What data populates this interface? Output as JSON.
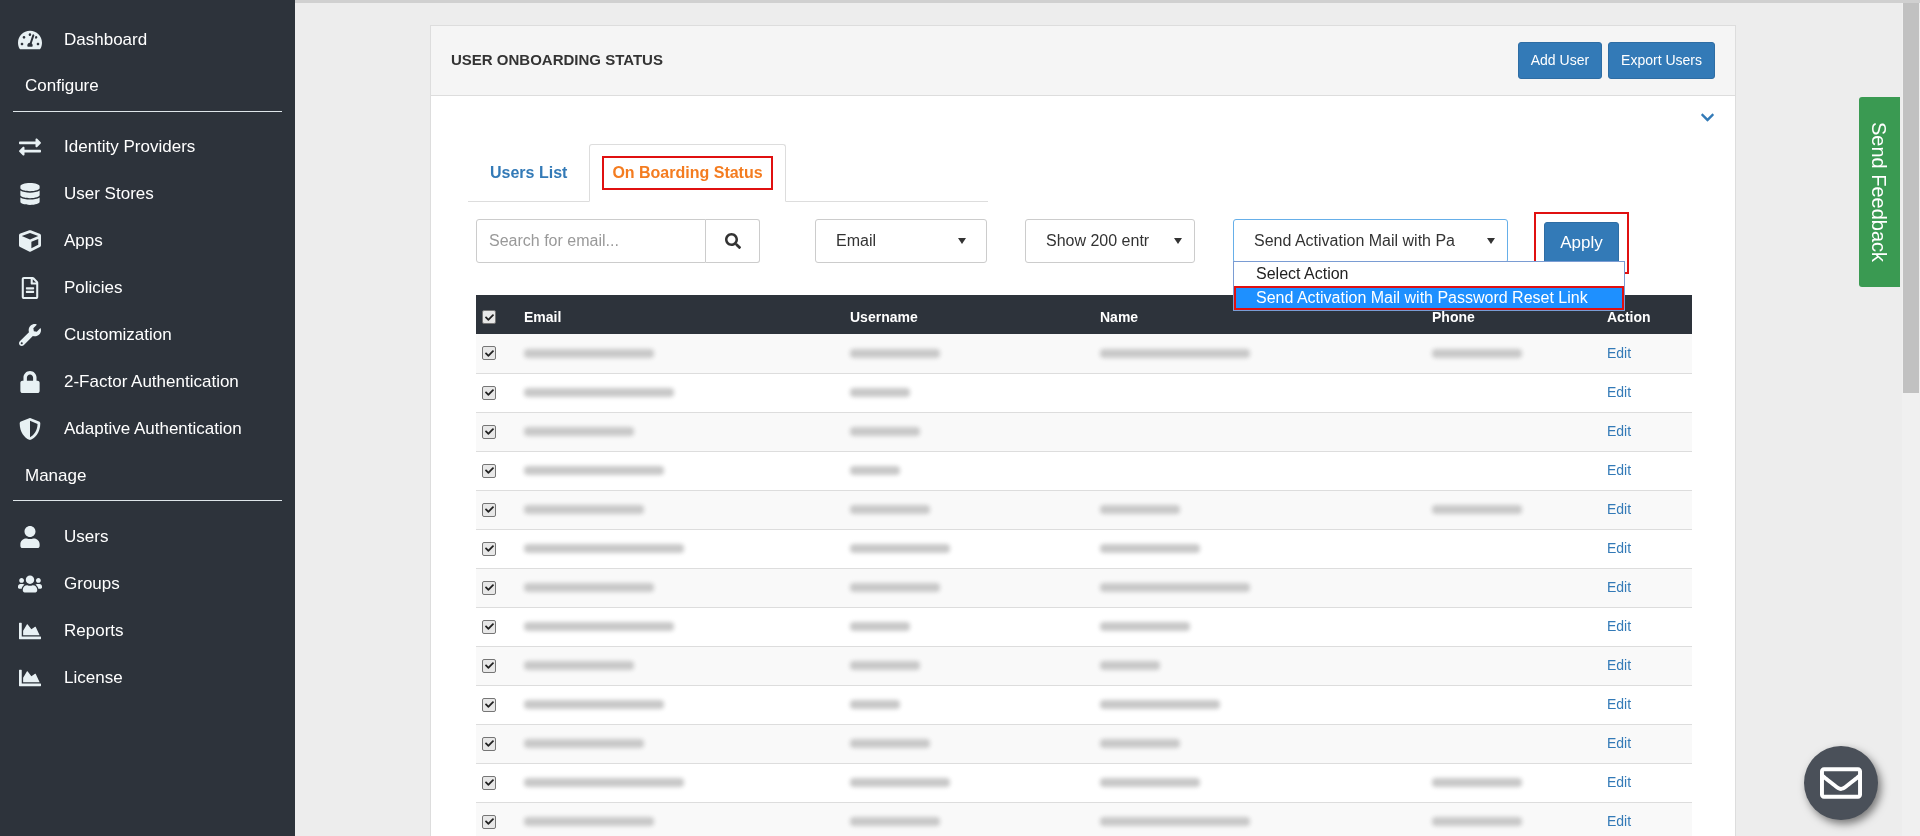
{
  "sidebar": [
    {
      "kind": "item",
      "label": "Dashboard"
    },
    {
      "kind": "section",
      "label": "Configure"
    },
    {
      "kind": "item",
      "label": "Identity Providers"
    },
    {
      "kind": "item",
      "label": "User Stores"
    },
    {
      "kind": "item",
      "label": "Apps"
    },
    {
      "kind": "item",
      "label": "Policies"
    },
    {
      "kind": "item",
      "label": "Customization"
    },
    {
      "kind": "item",
      "label": "2-Factor Authentication"
    },
    {
      "kind": "item",
      "label": "Adaptive Authentication"
    },
    {
      "kind": "section",
      "label": "Manage"
    },
    {
      "kind": "item",
      "label": "Users"
    },
    {
      "kind": "item",
      "label": "Groups"
    },
    {
      "kind": "item",
      "label": "Reports"
    },
    {
      "kind": "item",
      "label": "License"
    }
  ],
  "panel": {
    "title": "USER ONBOARDING STATUS",
    "buttons": [
      "Add User",
      "Export Users"
    ]
  },
  "tabs": [
    {
      "label": "Users List",
      "selected": false,
      "highlighted": false
    },
    {
      "label": "On Boarding Status",
      "selected": true,
      "highlighted": true
    }
  ],
  "search": {
    "placeholder": "Search for email..."
  },
  "filter_select": {
    "value": "Email"
  },
  "entries_select": {
    "value": "Show 200 entr"
  },
  "action_select": {
    "value": "Send Activation Mail with Pa",
    "expanded": true,
    "options": [
      {
        "label": "Select Action",
        "selected": false,
        "highlighted": false
      },
      {
        "label": "Send Activation Mail with Password Reset Link",
        "selected": true,
        "highlighted": true
      }
    ]
  },
  "apply_button": {
    "label": "Apply",
    "highlighted": true
  },
  "table": {
    "select_all_checked": true,
    "columns": [
      "Email",
      "Username",
      "Name",
      "Phone",
      "Action"
    ],
    "rows": [
      {
        "checked": true,
        "blurred": [
          true,
          true,
          true,
          true
        ],
        "action": "Edit"
      },
      {
        "checked": true,
        "blurred": [
          true,
          true,
          false,
          false
        ],
        "action": "Edit"
      },
      {
        "checked": true,
        "blurred": [
          true,
          true,
          false,
          false
        ],
        "action": "Edit"
      },
      {
        "checked": true,
        "blurred": [
          true,
          true,
          false,
          false
        ],
        "action": "Edit"
      },
      {
        "checked": true,
        "blurred": [
          true,
          true,
          true,
          true
        ],
        "action": "Edit"
      },
      {
        "checked": true,
        "blurred": [
          true,
          true,
          true,
          false
        ],
        "action": "Edit"
      },
      {
        "checked": true,
        "blurred": [
          true,
          true,
          true,
          false
        ],
        "action": "Edit"
      },
      {
        "checked": true,
        "blurred": [
          true,
          true,
          true,
          false
        ],
        "action": "Edit"
      },
      {
        "checked": true,
        "blurred": [
          true,
          true,
          true,
          false
        ],
        "action": "Edit"
      },
      {
        "checked": true,
        "blurred": [
          true,
          true,
          true,
          false
        ],
        "action": "Edit"
      },
      {
        "checked": true,
        "blurred": [
          true,
          true,
          true,
          false
        ],
        "action": "Edit"
      },
      {
        "checked": true,
        "blurred": [
          true,
          true,
          true,
          true
        ],
        "action": "Edit"
      },
      {
        "checked": true,
        "blurred": [
          true,
          true,
          true,
          true
        ],
        "action": "Edit"
      }
    ]
  },
  "feedback_tab": {
    "label": "Send Feedback"
  }
}
